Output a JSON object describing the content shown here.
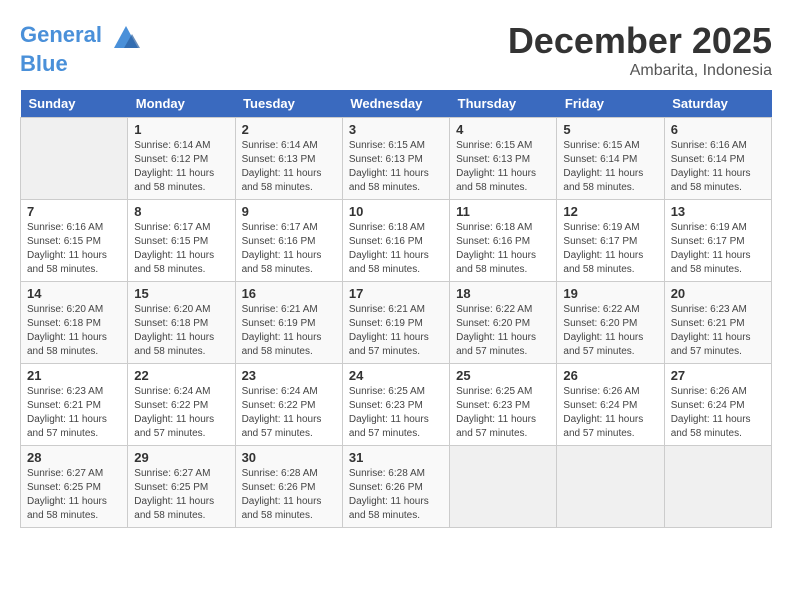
{
  "header": {
    "logo_line1": "General",
    "logo_line2": "Blue",
    "month": "December 2025",
    "location": "Ambarita, Indonesia"
  },
  "days_of_week": [
    "Sunday",
    "Monday",
    "Tuesday",
    "Wednesday",
    "Thursday",
    "Friday",
    "Saturday"
  ],
  "weeks": [
    [
      {
        "day": "",
        "info": ""
      },
      {
        "day": "1",
        "info": "Sunrise: 6:14 AM\nSunset: 6:12 PM\nDaylight: 11 hours and 58 minutes."
      },
      {
        "day": "2",
        "info": "Sunrise: 6:14 AM\nSunset: 6:13 PM\nDaylight: 11 hours and 58 minutes."
      },
      {
        "day": "3",
        "info": "Sunrise: 6:15 AM\nSunset: 6:13 PM\nDaylight: 11 hours and 58 minutes."
      },
      {
        "day": "4",
        "info": "Sunrise: 6:15 AM\nSunset: 6:13 PM\nDaylight: 11 hours and 58 minutes."
      },
      {
        "day": "5",
        "info": "Sunrise: 6:15 AM\nSunset: 6:14 PM\nDaylight: 11 hours and 58 minutes."
      },
      {
        "day": "6",
        "info": "Sunrise: 6:16 AM\nSunset: 6:14 PM\nDaylight: 11 hours and 58 minutes."
      }
    ],
    [
      {
        "day": "7",
        "info": "Sunrise: 6:16 AM\nSunset: 6:15 PM\nDaylight: 11 hours and 58 minutes."
      },
      {
        "day": "8",
        "info": "Sunrise: 6:17 AM\nSunset: 6:15 PM\nDaylight: 11 hours and 58 minutes."
      },
      {
        "day": "9",
        "info": "Sunrise: 6:17 AM\nSunset: 6:16 PM\nDaylight: 11 hours and 58 minutes."
      },
      {
        "day": "10",
        "info": "Sunrise: 6:18 AM\nSunset: 6:16 PM\nDaylight: 11 hours and 58 minutes."
      },
      {
        "day": "11",
        "info": "Sunrise: 6:18 AM\nSunset: 6:16 PM\nDaylight: 11 hours and 58 minutes."
      },
      {
        "day": "12",
        "info": "Sunrise: 6:19 AM\nSunset: 6:17 PM\nDaylight: 11 hours and 58 minutes."
      },
      {
        "day": "13",
        "info": "Sunrise: 6:19 AM\nSunset: 6:17 PM\nDaylight: 11 hours and 58 minutes."
      }
    ],
    [
      {
        "day": "14",
        "info": "Sunrise: 6:20 AM\nSunset: 6:18 PM\nDaylight: 11 hours and 58 minutes."
      },
      {
        "day": "15",
        "info": "Sunrise: 6:20 AM\nSunset: 6:18 PM\nDaylight: 11 hours and 58 minutes."
      },
      {
        "day": "16",
        "info": "Sunrise: 6:21 AM\nSunset: 6:19 PM\nDaylight: 11 hours and 58 minutes."
      },
      {
        "day": "17",
        "info": "Sunrise: 6:21 AM\nSunset: 6:19 PM\nDaylight: 11 hours and 57 minutes."
      },
      {
        "day": "18",
        "info": "Sunrise: 6:22 AM\nSunset: 6:20 PM\nDaylight: 11 hours and 57 minutes."
      },
      {
        "day": "19",
        "info": "Sunrise: 6:22 AM\nSunset: 6:20 PM\nDaylight: 11 hours and 57 minutes."
      },
      {
        "day": "20",
        "info": "Sunrise: 6:23 AM\nSunset: 6:21 PM\nDaylight: 11 hours and 57 minutes."
      }
    ],
    [
      {
        "day": "21",
        "info": "Sunrise: 6:23 AM\nSunset: 6:21 PM\nDaylight: 11 hours and 57 minutes."
      },
      {
        "day": "22",
        "info": "Sunrise: 6:24 AM\nSunset: 6:22 PM\nDaylight: 11 hours and 57 minutes."
      },
      {
        "day": "23",
        "info": "Sunrise: 6:24 AM\nSunset: 6:22 PM\nDaylight: 11 hours and 57 minutes."
      },
      {
        "day": "24",
        "info": "Sunrise: 6:25 AM\nSunset: 6:23 PM\nDaylight: 11 hours and 57 minutes."
      },
      {
        "day": "25",
        "info": "Sunrise: 6:25 AM\nSunset: 6:23 PM\nDaylight: 11 hours and 57 minutes."
      },
      {
        "day": "26",
        "info": "Sunrise: 6:26 AM\nSunset: 6:24 PM\nDaylight: 11 hours and 57 minutes."
      },
      {
        "day": "27",
        "info": "Sunrise: 6:26 AM\nSunset: 6:24 PM\nDaylight: 11 hours and 58 minutes."
      }
    ],
    [
      {
        "day": "28",
        "info": "Sunrise: 6:27 AM\nSunset: 6:25 PM\nDaylight: 11 hours and 58 minutes."
      },
      {
        "day": "29",
        "info": "Sunrise: 6:27 AM\nSunset: 6:25 PM\nDaylight: 11 hours and 58 minutes."
      },
      {
        "day": "30",
        "info": "Sunrise: 6:28 AM\nSunset: 6:26 PM\nDaylight: 11 hours and 58 minutes."
      },
      {
        "day": "31",
        "info": "Sunrise: 6:28 AM\nSunset: 6:26 PM\nDaylight: 11 hours and 58 minutes."
      },
      {
        "day": "",
        "info": ""
      },
      {
        "day": "",
        "info": ""
      },
      {
        "day": "",
        "info": ""
      }
    ]
  ]
}
